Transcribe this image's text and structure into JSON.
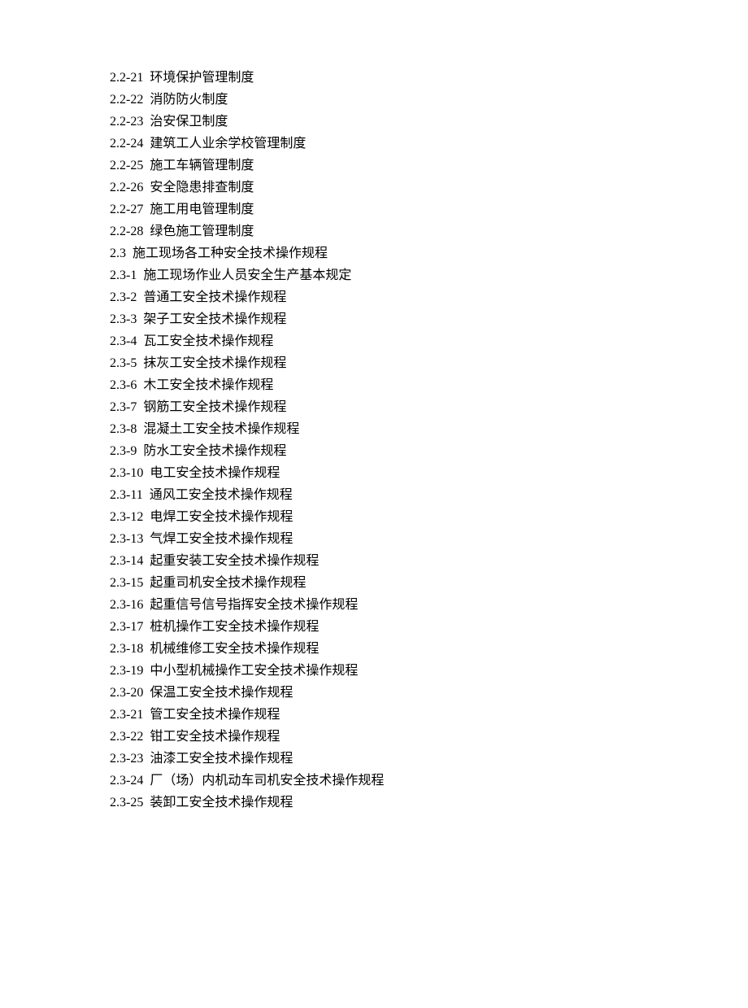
{
  "entries": [
    {
      "num": "2.2-21",
      "title": "环境保护管理制度"
    },
    {
      "num": "2.2-22",
      "title": "消防防火制度"
    },
    {
      "num": "2.2-23",
      "title": "治安保卫制度"
    },
    {
      "num": "2.2-24",
      "title": "建筑工人业余学校管理制度"
    },
    {
      "num": "2.2-25",
      "title": "施工车辆管理制度"
    },
    {
      "num": "2.2-26",
      "title": "安全隐患排查制度"
    },
    {
      "num": "2.2-27",
      "title": "施工用电管理制度"
    },
    {
      "num": "2.2-28",
      "title": "绿色施工管理制度"
    },
    {
      "num": "2.3",
      "title": "施工现场各工种安全技术操作规程"
    },
    {
      "num": "2.3-1",
      "title": "施工现场作业人员安全生产基本规定"
    },
    {
      "num": "2.3-2",
      "title": "普通工安全技术操作规程"
    },
    {
      "num": "2.3-3",
      "title": "架子工安全技术操作规程"
    },
    {
      "num": "2.3-4",
      "title": "瓦工安全技术操作规程"
    },
    {
      "num": "2.3-5",
      "title": "抹灰工安全技术操作规程"
    },
    {
      "num": "2.3-6",
      "title": "木工安全技术操作规程"
    },
    {
      "num": "2.3-7",
      "title": "钢筋工安全技术操作规程"
    },
    {
      "num": "2.3-8",
      "title": "混凝土工安全技术操作规程"
    },
    {
      "num": "2.3-9",
      "title": "防水工安全技术操作规程"
    },
    {
      "num": "2.3-10",
      "title": "电工安全技术操作规程"
    },
    {
      "num": "2.3-11",
      "title": "通风工安全技术操作规程"
    },
    {
      "num": "2.3-12",
      "title": "电焊工安全技术操作规程"
    },
    {
      "num": "2.3-13",
      "title": "气焊工安全技术操作规程"
    },
    {
      "num": "2.3-14",
      "title": "起重安装工安全技术操作规程"
    },
    {
      "num": "2.3-15",
      "title": "起重司机安全技术操作规程"
    },
    {
      "num": "2.3-16",
      "title": "起重信号信号指挥安全技术操作规程"
    },
    {
      "num": "2.3-17",
      "title": "桩机操作工安全技术操作规程"
    },
    {
      "num": "2.3-18",
      "title": "机械维修工安全技术操作规程"
    },
    {
      "num": "2.3-19",
      "title": "中小型机械操作工安全技术操作规程"
    },
    {
      "num": "2.3-20",
      "title": "保温工安全技术操作规程"
    },
    {
      "num": "2.3-21",
      "title": "管工安全技术操作规程"
    },
    {
      "num": "2.3-22",
      "title": "钳工安全技术操作规程"
    },
    {
      "num": "2.3-23",
      "title": "油漆工安全技术操作规程"
    },
    {
      "num": "2.3-24",
      "title": "厂（场）内机动车司机安全技术操作规程"
    },
    {
      "num": "2.3-25",
      "title": "装卸工安全技术操作规程"
    }
  ]
}
